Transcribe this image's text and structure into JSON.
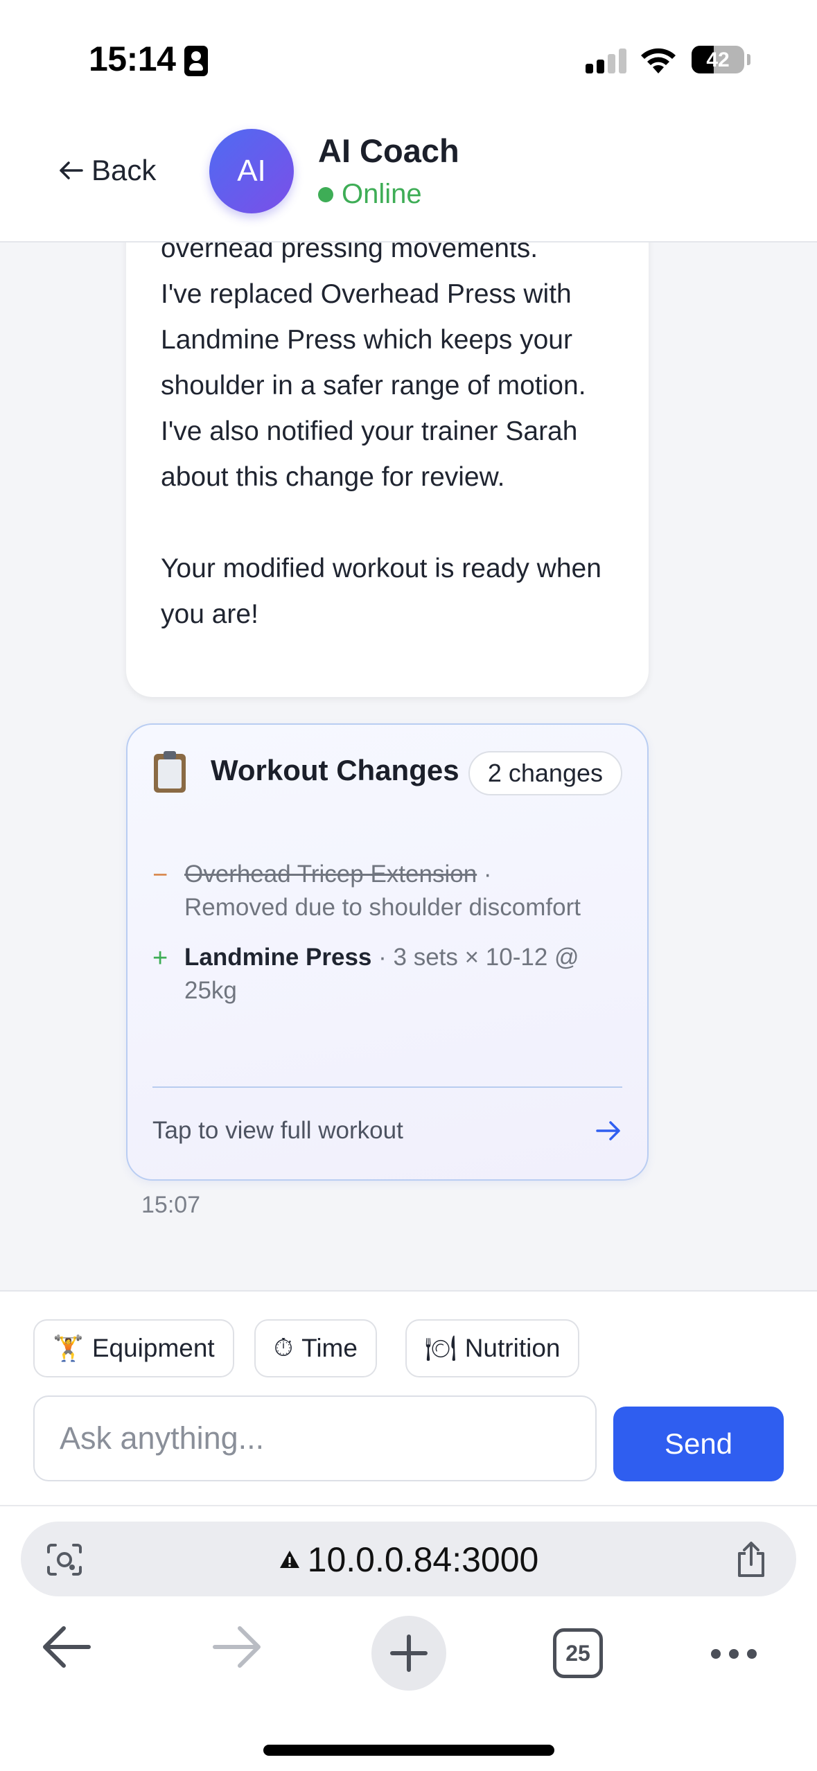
{
  "status_bar": {
    "time": "15:14",
    "battery_percent": "42"
  },
  "header": {
    "back_label": "Back",
    "avatar_initials": "AI",
    "title": "AI Coach",
    "status": "Online",
    "status_color": "#3ead56"
  },
  "messages": {
    "coach_message": "overhead pressing movements.\nI've replaced Overhead Press with Landmine Press which keeps your shoulder in a safer range of motion. I've also notified your trainer Sarah about this change for review.\n\nYour modified workout is ready when you are!",
    "changes_card": {
      "icon": "clipboard-icon",
      "title": "Workout Changes",
      "badge": "2 changes",
      "removed": {
        "sign": "−",
        "name": "Overhead Tricep Extension",
        "separator": " · ",
        "detail": "Removed due to shoulder discomfort"
      },
      "added": {
        "sign": "+",
        "name": "Landmine Press",
        "separator": " · ",
        "detail": "3 sets × 10-12 @ 25kg"
      },
      "footer": "Tap to view full workout"
    },
    "timestamp": "15:07"
  },
  "composer": {
    "chips": [
      {
        "icon": "🏋",
        "label": "Equipment"
      },
      {
        "icon": "⏱",
        "label": "Time"
      },
      {
        "icon": "🍽",
        "label": "Nutrition"
      }
    ],
    "input_placeholder": "Ask anything...",
    "send_label": "Send",
    "accent_color": "#2f5ef0"
  },
  "browser": {
    "url": "10.0.0.84:3000",
    "tab_count": "25"
  }
}
